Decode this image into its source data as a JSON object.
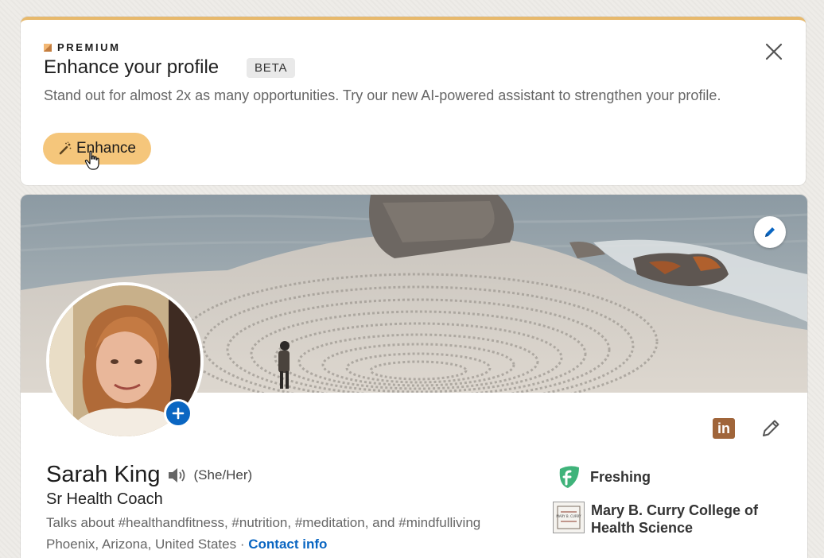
{
  "premium": {
    "label": "PREMIUM",
    "title": "Enhance your profile",
    "badge": "BETA",
    "description": "Stand out for almost 2x as many opportunities. Try our new AI-powered assistant to strengthen your profile.",
    "button_label": "Enhance",
    "button_icon": "magic-wand-icon",
    "close_icon": "close-icon"
  },
  "profile": {
    "name": "Sarah King",
    "pronouns": "(She/Her)",
    "pronunciation_icon": "speaker-icon",
    "headline": "Sr Health Coach",
    "talks_about": "Talks about #healthandfitness, #nutrition, #meditation, and #mindfulliving",
    "location": "Phoenix, Arizona, United States",
    "separator": "·",
    "contact_link": "Contact info",
    "linkedin_glyph": "in",
    "company": "Freshing",
    "school": "Mary B. Curry College of Health Science",
    "school_logo_text": "MARY B. CURRY"
  },
  "colors": {
    "accent": "#0a66c2",
    "premium_gold": "#f5c67b",
    "premium_border": "#e7b96c",
    "linkedin_badge": "#a0653a",
    "freshing_green": "#3fb37a"
  }
}
